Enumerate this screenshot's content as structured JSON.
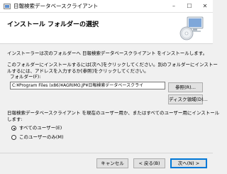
{
  "window": {
    "title": "日報検索データベースクライアント",
    "minimize_glyph": "–",
    "maximize_glyph": "☐",
    "close_glyph": "✕"
  },
  "header": {
    "title": "インストール フォルダーの選択"
  },
  "body": {
    "intro": "インストーラーは次のフォルダーへ 日報検索データベースクライアント をインストールします。",
    "instruction_line1": "このフォルダーにインストールするには[次へ]をクリックしてください。別のフォルダーにインストー",
    "instruction_line2": "ルするには、アドレスを入力するか[参照]をクリックしてください。",
    "folder_label": "フォルダー(F):",
    "folder_value": "C:¥Program Files (x86)¥AGRIMO.JP¥日報検索データベースクライ",
    "browse_button": "参照(R)...",
    "disk_cost_button": "ディスク領域(D)...",
    "users_line1": "日報検索データベースクライアント を現在のユーザー用か、またはすべてのユーザー用にインストール",
    "users_line2": "します:",
    "options": [
      {
        "label": "すべてのユーザー(E)",
        "checked": true
      },
      {
        "label": "このユーザーのみ(M)",
        "checked": false
      }
    ]
  },
  "footer": {
    "cancel_button": "キャンセル",
    "back_button": "< 戻る(B)",
    "next_button": "次へ(N) >"
  }
}
